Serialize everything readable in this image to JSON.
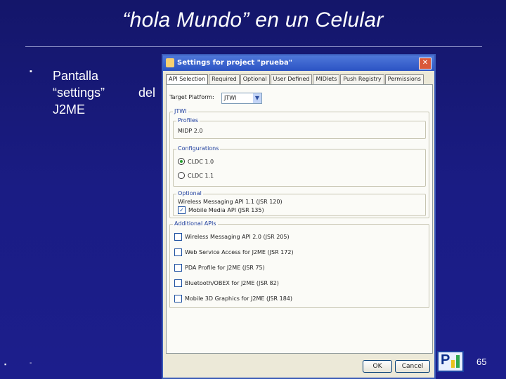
{
  "slide": {
    "title": "“hola Mundo” en un Celular",
    "bullet_marker": "▪",
    "bullet_line1": "Pantalla",
    "bullet_line2": "“settings”",
    "bullet_line2b": "del",
    "bullet_line3": "J2ME",
    "footer_dot": "▪",
    "footer_dash": "-",
    "page_number": "65",
    "logo_text": "P"
  },
  "dialog": {
    "title": "Settings for project \"prueba\"",
    "close_glyph": "✕",
    "tabs": [
      "API Selection",
      "Required",
      "Optional",
      "User Defined",
      "MIDlets",
      "Push Registry",
      "Permissions"
    ],
    "target_platform_label": "Target Platform:",
    "target_platform_value": "JTWI",
    "jtwi_legend": "JTWI",
    "profiles_legend": "Profiles",
    "profile_value": "MIDP 2.0",
    "configurations_legend": "Configurations",
    "config_options": [
      "CLDC 1.0",
      "CLDC 1.1"
    ],
    "optional_legend": "Optional",
    "optional_items": [
      "Wireless Messaging API 1.1 (JSR 120)",
      "Mobile Media API (JSR 135)"
    ],
    "additional_legend": "Additional APIs",
    "additional_items": [
      "Wireless Messaging API 2.0 (JSR 205)",
      "Web Service Access for J2ME (JSR 172)",
      "PDA Profile for J2ME (JSR 75)",
      "Bluetooth/OBEX for J2ME (JSR 82)",
      "Mobile 3D Graphics for J2ME (JSR 184)"
    ],
    "ok_label": "OK",
    "cancel_label": "Cancel"
  }
}
